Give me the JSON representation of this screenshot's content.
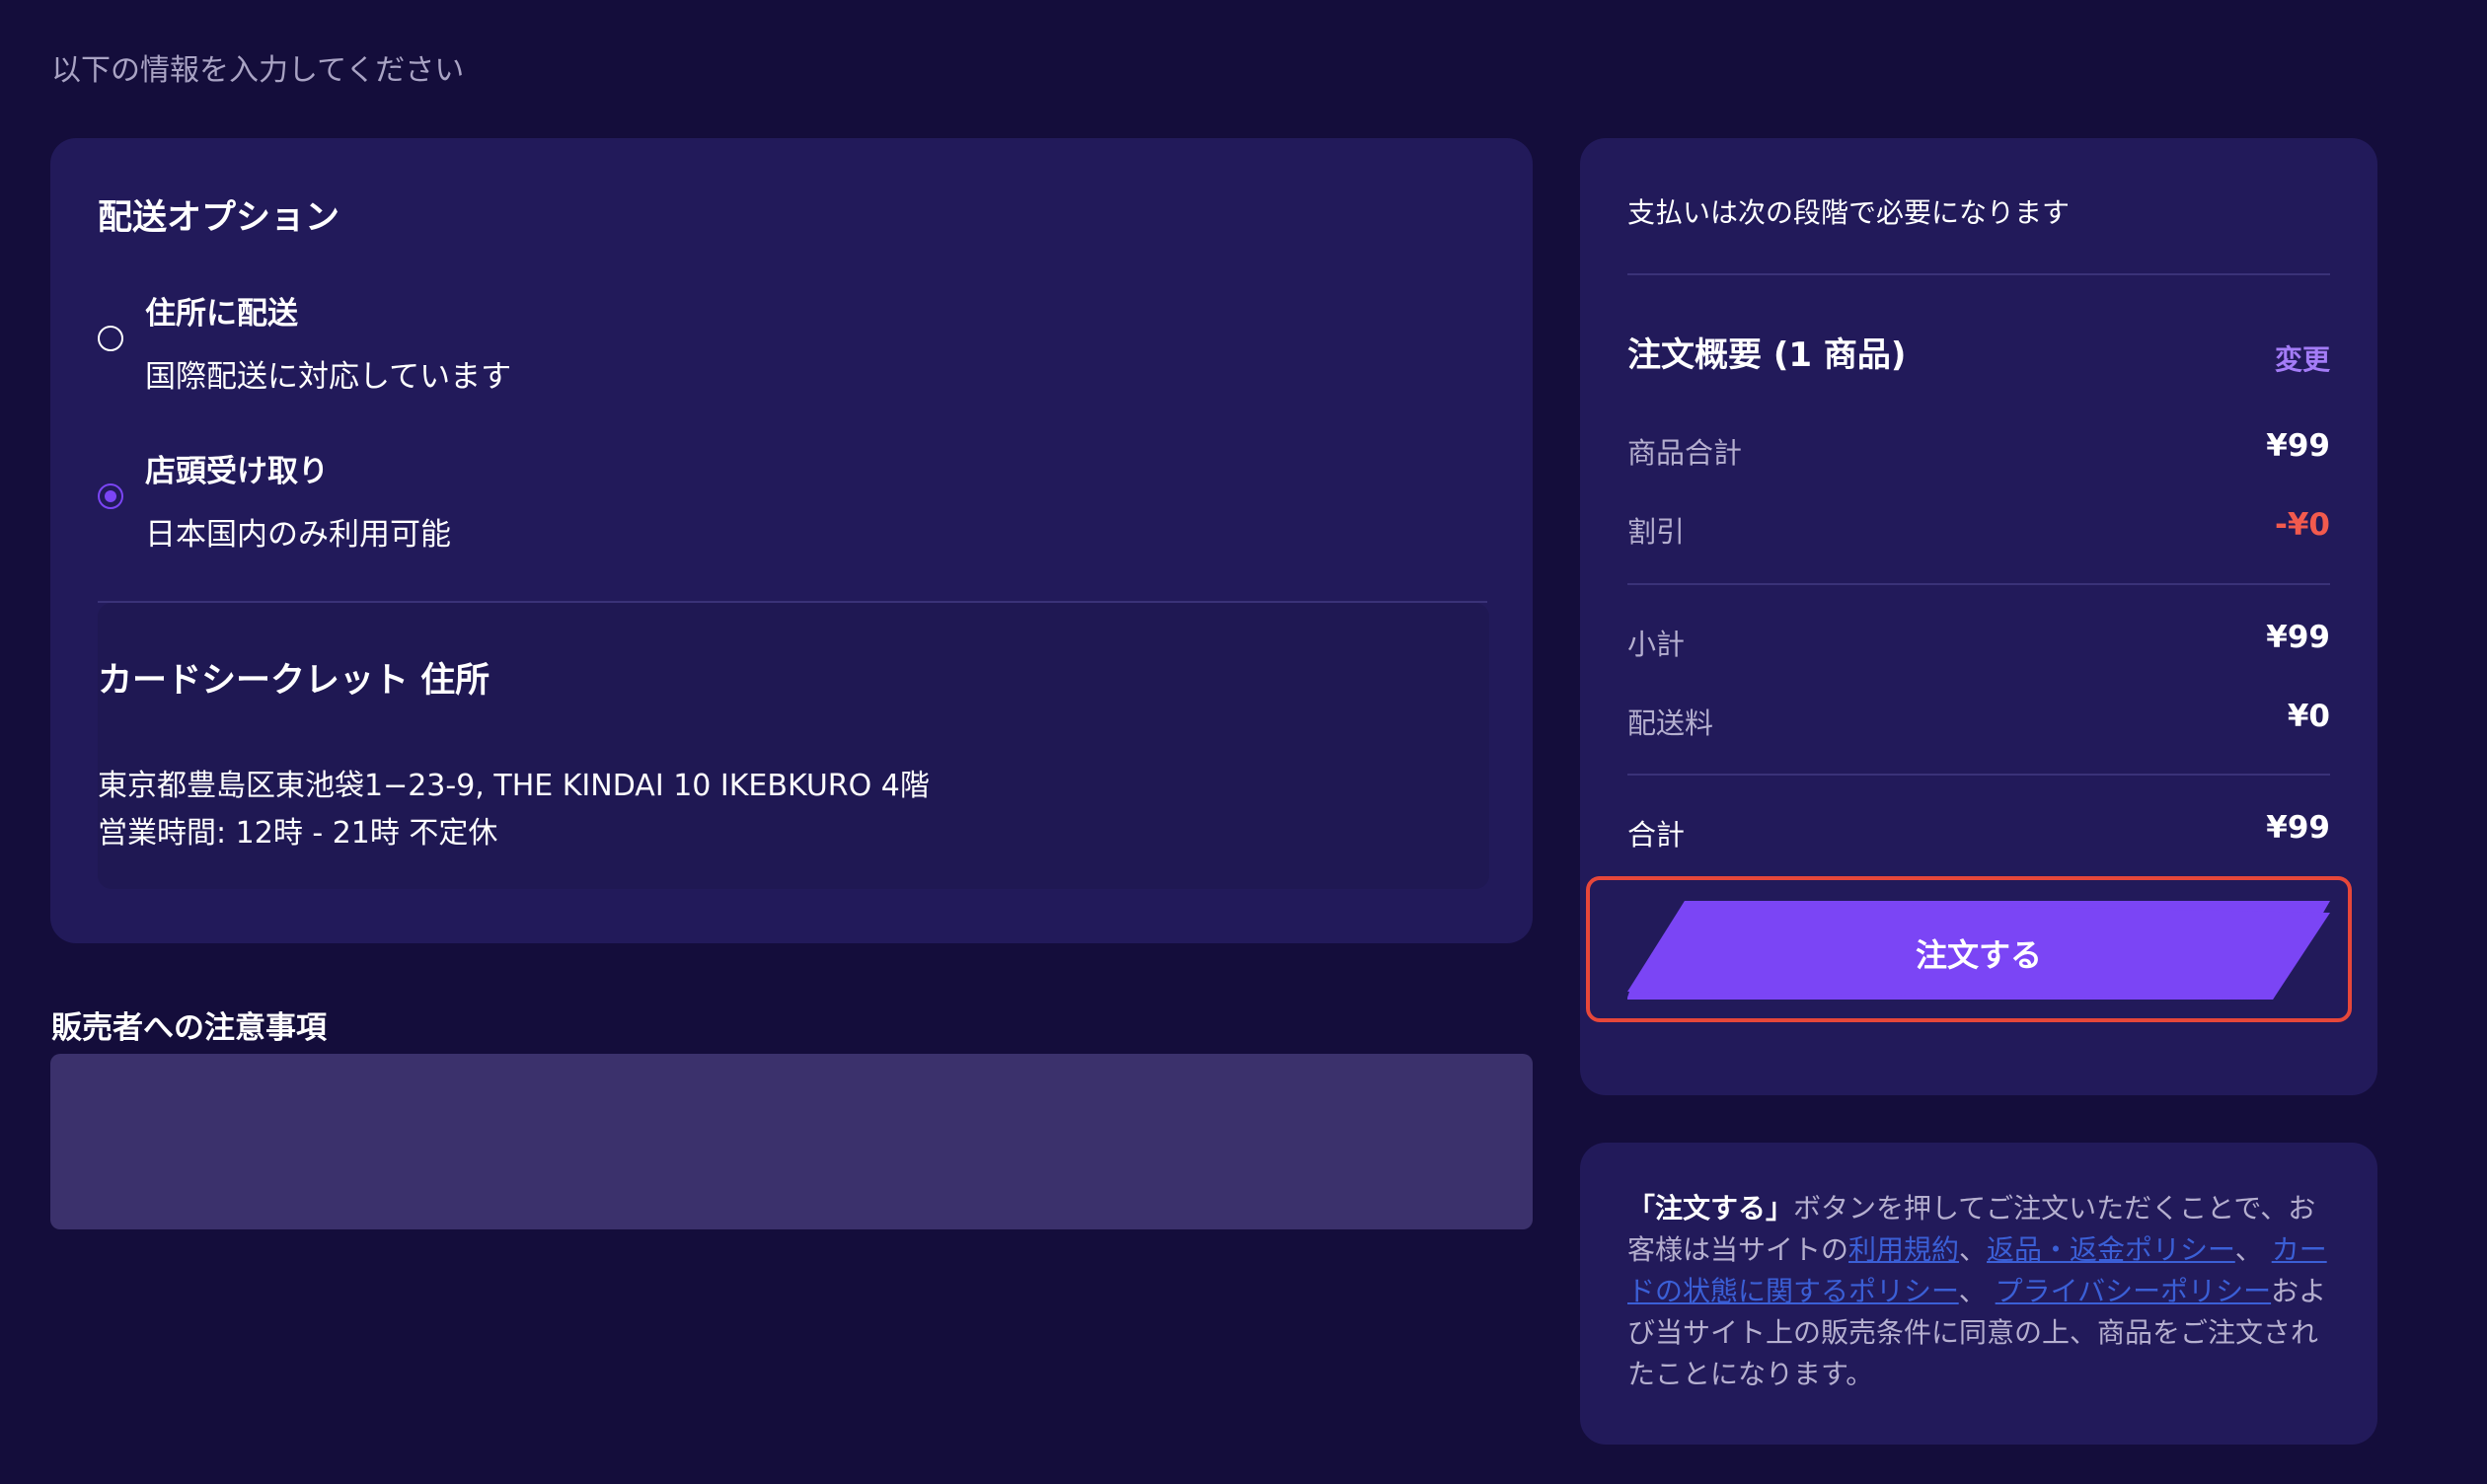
{
  "header": {
    "instructions": "以下の情報を入力してください"
  },
  "shipping": {
    "title": "配送オプション",
    "options": [
      {
        "label": "住所に配送",
        "description": "国際配送に対応しています",
        "selected": false
      },
      {
        "label": "店頭受け取り",
        "description": "日本国内のみ利用可能",
        "selected": true
      }
    ],
    "store": {
      "title": "カードシークレット 住所",
      "address": "東京都豊島区東池袋1−23-9, THE KINDAI 10 IKEBKURO 4階",
      "hours": "営業時間: 12時 - 21時 不定休"
    }
  },
  "notes": {
    "label": "販売者への注意事項",
    "value": ""
  },
  "summary": {
    "payment_note": "支払いは次の段階で必要になります",
    "title": "注文概要 (1 商品)",
    "change_label": "変更",
    "rows": {
      "items_total_label": "商品合計",
      "items_total_value": "¥99",
      "discount_label": "割引",
      "discount_value": "-¥0",
      "subtotal_label": "小計",
      "subtotal_value": "¥99",
      "shipping_label": "配送料",
      "shipping_value": "¥0",
      "total_label": "合計",
      "total_value": "¥99"
    },
    "order_button": "注文する",
    "colors": {
      "button": "#7b45f5",
      "highlight": "#e7473a",
      "discount": "#f25a4d"
    }
  },
  "terms": {
    "bold": "「注文する」",
    "text1": "ボタンを押してご注文いただくことで、お客様は当サイトの",
    "link_terms": "利用規約",
    "sep1": "、",
    "link_returns": "返品・返金ポリシー",
    "sep2": "、 ",
    "link_condition": "カードの状態に関するポリシー",
    "sep3": "、 ",
    "link_privacy": "プライバシーポリシー",
    "text2": "および当サイト上の販売条件に同意の上、商品をご注文されたことになります。"
  }
}
